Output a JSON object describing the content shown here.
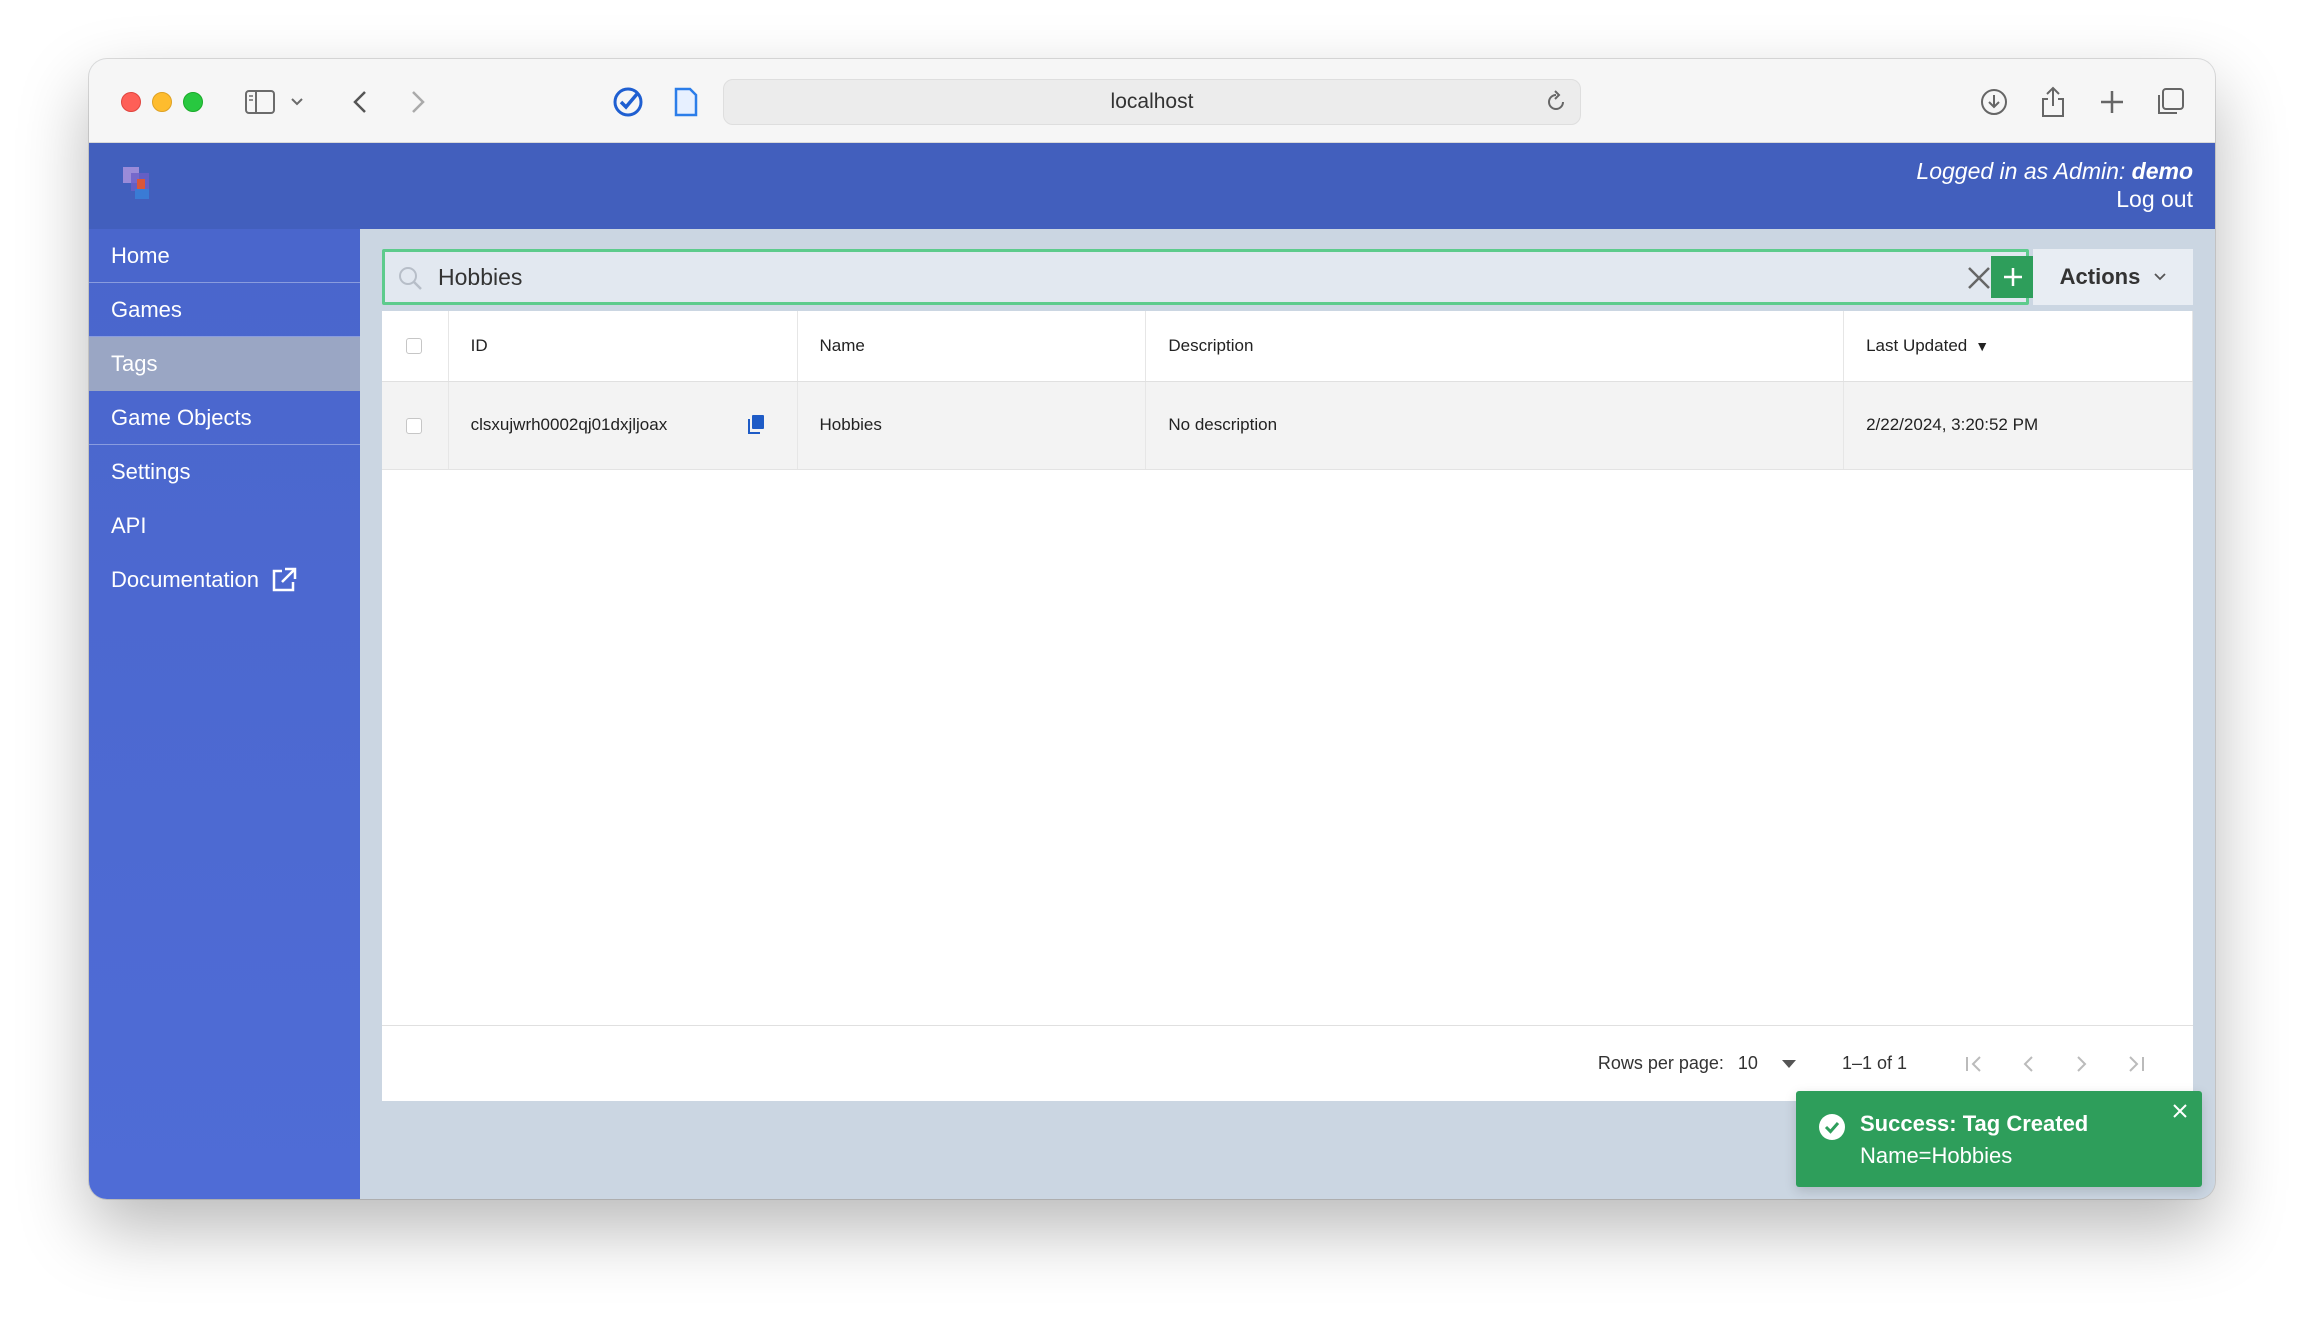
{
  "browser": {
    "url": "localhost"
  },
  "header": {
    "logged_in_prefix": "Logged in as Admin:",
    "username": "demo",
    "logout_label": "Log out"
  },
  "sidebar": {
    "items": [
      {
        "label": "Home"
      },
      {
        "label": "Games"
      },
      {
        "label": "Tags"
      },
      {
        "label": "Game Objects"
      },
      {
        "label": "Settings"
      },
      {
        "label": "API"
      },
      {
        "label": "Documentation"
      }
    ]
  },
  "search": {
    "value": "Hobbies"
  },
  "actions": {
    "label": "Actions"
  },
  "table": {
    "columns": {
      "id": "ID",
      "name": "Name",
      "description": "Description",
      "last_updated": "Last Updated"
    },
    "rows": [
      {
        "id": "clsxujwrh0002qj01dxjljoax",
        "name": "Hobbies",
        "description": "No description",
        "last_updated": "2/22/2024, 3:20:52 PM"
      }
    ]
  },
  "pagination": {
    "rows_per_page_label": "Rows per page:",
    "rows_per_page": "10",
    "range": "1–1 of 1"
  },
  "toast": {
    "title": "Success: Tag Created",
    "message": "Name=Hobbies"
  },
  "colors": {
    "header": "#425fbd",
    "sidebar": "#4f6cd6",
    "success": "#2e9e5b",
    "main_bg": "#cbd6e2"
  }
}
